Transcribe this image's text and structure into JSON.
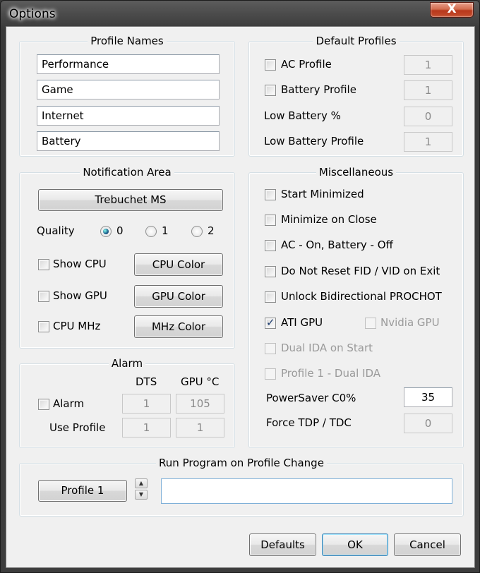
{
  "window": {
    "title": "Options",
    "close_glyph": "X"
  },
  "profile_names": {
    "label": "Profile Names",
    "names": [
      "Performance",
      "Game",
      "Internet",
      "Battery"
    ]
  },
  "default_profiles": {
    "label": "Default Profiles",
    "ac_profile": {
      "label": "AC Profile",
      "checked": false,
      "value": "1"
    },
    "battery_profile": {
      "label": "Battery Profile",
      "checked": false,
      "value": "1"
    },
    "low_battery_pct": {
      "label": "Low Battery %",
      "value": "0"
    },
    "low_battery_profile": {
      "label": "Low Battery Profile",
      "value": "1"
    }
  },
  "notification": {
    "label": "Notification Area",
    "font_button": "Trebuchet MS",
    "quality_label": "Quality",
    "quality_options": [
      "0",
      "1",
      "2"
    ],
    "quality_selected": "0",
    "show_cpu": {
      "label": "Show CPU",
      "checked": false,
      "color_button": "CPU Color"
    },
    "show_gpu": {
      "label": "Show GPU",
      "checked": false,
      "color_button": "GPU Color"
    },
    "cpu_mhz": {
      "label": "CPU MHz",
      "checked": false,
      "color_button": "MHz Color"
    }
  },
  "alarm": {
    "label": "Alarm",
    "col_dts": "DTS",
    "col_gpu": "GPU °C",
    "alarm_checkbox": {
      "label": "Alarm",
      "checked": false
    },
    "alarm_dts": "1",
    "alarm_gpu": "105",
    "use_profile_label": "Use Profile",
    "use_profile_dts": "1",
    "use_profile_gpu": "1"
  },
  "misc": {
    "label": "Miscellaneous",
    "start_minimized": {
      "label": "Start Minimized",
      "checked": false
    },
    "minimize_on_close": {
      "label": "Minimize on Close",
      "checked": false
    },
    "ac_on_battery_off": {
      "label": "AC - On, Battery - Off",
      "checked": false
    },
    "do_not_reset": {
      "label": "Do Not Reset FID / VID on Exit",
      "checked": false
    },
    "unlock_prochot": {
      "label": "Unlock Bidirectional PROCHOT",
      "checked": false
    },
    "ati_gpu": {
      "label": "ATI GPU",
      "checked": true
    },
    "nvidia_gpu": {
      "label": "Nvidia GPU",
      "checked": false,
      "disabled": true
    },
    "dual_ida": {
      "label": "Dual IDA on Start",
      "checked": false,
      "disabled": true
    },
    "profile1_dual_ida": {
      "label": "Profile 1 - Dual IDA",
      "checked": false,
      "disabled": true
    },
    "powersaver": {
      "label": "PowerSaver C0%",
      "value": "35"
    },
    "force_tdp": {
      "label": "Force TDP / TDC",
      "value": "0"
    }
  },
  "run_program": {
    "label": "Run Program on Profile Change",
    "profile_button": "Profile 1",
    "spin_up": "▲",
    "spin_down": "▼",
    "path_value": ""
  },
  "footer": {
    "defaults": "Defaults",
    "ok": "OK",
    "cancel": "Cancel"
  }
}
